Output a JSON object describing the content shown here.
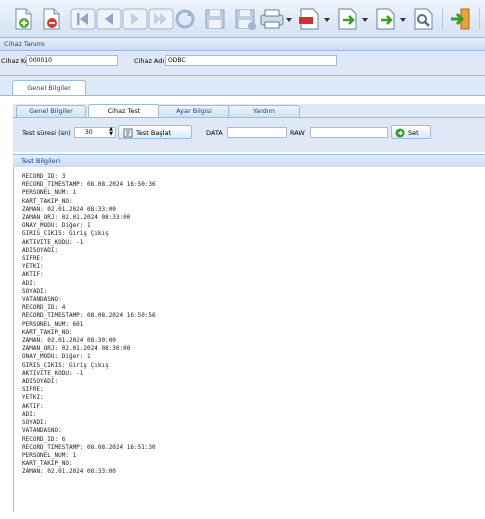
{
  "toolbar": {
    "buttons": [
      "new-doc-icon",
      "delete-doc-icon",
      "first-icon",
      "prev-icon",
      "next-icon",
      "last-icon",
      "refresh-icon",
      "save-icon",
      "save-as-icon",
      "print-icon",
      "pdf-icon",
      "export-icon",
      "import-icon",
      "preview-icon",
      "exit-icon"
    ]
  },
  "device_section": {
    "title": "Cihaz Tanımı",
    "code_label": "Cihaz Kodu",
    "code_value": "000010",
    "name_label": "Cihaz Adı",
    "name_value": "ODBC"
  },
  "outer_tab": {
    "label": "Genel Bilgiler"
  },
  "inner_tabs": [
    {
      "label": "Genel Bilgiler"
    },
    {
      "label": "Cihaz Test"
    },
    {
      "label": "Ayar Bilgisi"
    },
    {
      "label": "Yardım"
    }
  ],
  "test_panel": {
    "duration_label": "Test süresi (sn)",
    "duration_value": "30",
    "start_label": "Test Başlat",
    "data_label": "DATA",
    "data_value": "",
    "raw_label": "RAW",
    "raw_value": "",
    "set_label": "Set"
  },
  "log_panel": {
    "title": "Test Bilgileri",
    "text": "RECORD_ID: 3\nRECORD_TIMESTAMP: 08.08.2024 16:50:36\nPERSONEL_NUM: 1\nKART_TAKIP_NO:\nZAMAN: 02.01.2024 08:33:00\nZAMAN_ORJ: 02.01.2024 08:33:00\nONAY_MODU: Diğer: 1\nGIRIS_CIKIS: Giriş Çıkış\nAKTIVITE_KODU: -1\nADISOYADI:\nSIFRE:\nYETKI:\nAKTIF:\nADI:\nSOYADI:\nVATANDASNO:\nRECORD_ID: 4\nRECORD_TIMESTAMP: 08.08.2024 16:50:56\nPERSONEL_NUM: 601\nKART_TAKIP_NO:\nZAMAN: 02.01.2024 08:30:00\nZAMAN_ORJ: 02.01.2024 08:30:00\nONAY_MODU: Diğer: 1\nGIRIS_CIKIS: Giriş Çıkış\nAKTIVITE_KODU: -1\nADISOYADI:\nSIFRE:\nYETKI:\nAKTIF:\nADI:\nSOYADI:\nVATANDASNO:\nRECORD_ID: 6\nRECORD_TIMESTAMP: 08.08.2024 16:51:30\nPERSONEL_NUM: 1\nKART_TAKIP_NO:\nZAMAN: 02.01.2024 08:33:00"
  }
}
